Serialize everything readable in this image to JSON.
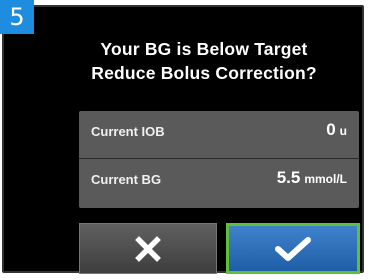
{
  "step_badge": "5",
  "dialog": {
    "title_line1": "Your BG is Below Target",
    "title_line2": "Reduce Bolus Correction?"
  },
  "info": {
    "rows": [
      {
        "label": "Current IOB",
        "value": "0",
        "unit": "u"
      },
      {
        "label": "Current BG",
        "value": "5.5",
        "unit": "mmol/L"
      }
    ]
  },
  "buttons": {
    "cancel_icon": "x-icon",
    "confirm_icon": "checkmark-icon"
  },
  "colors": {
    "badge": "#1f8ddf",
    "confirm_button": "#2a6db8",
    "confirm_border": "#5fbf3a",
    "cancel_button": "#4f4f4f",
    "panel": "#5a5a5a"
  }
}
